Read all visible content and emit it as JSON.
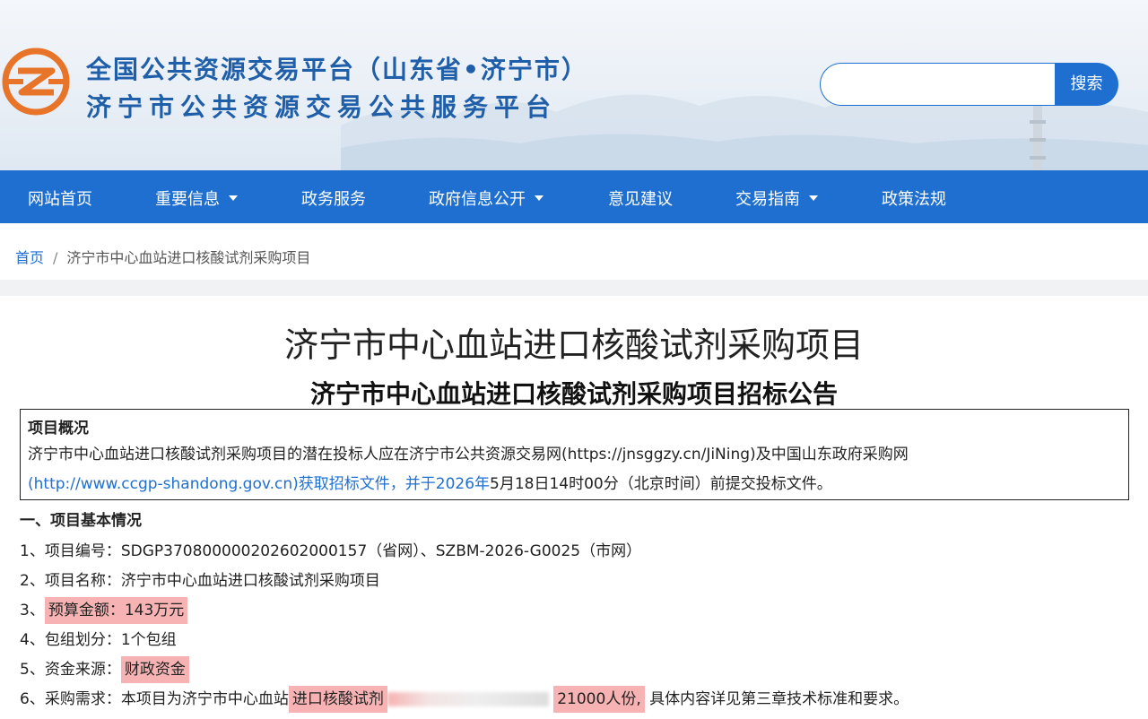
{
  "header": {
    "title_line1": "全国公共资源交易平台（山东省•济宁市）",
    "title_line2": "济宁市公共资源交易公共服务平台",
    "search_placeholder": "",
    "search_button": "搜索",
    "logo_icon": "jining-resource-logo-icon"
  },
  "nav": {
    "items": [
      {
        "label": "网站首页",
        "dropdown": false
      },
      {
        "label": "重要信息",
        "dropdown": true
      },
      {
        "label": "政务服务",
        "dropdown": false
      },
      {
        "label": "政府信息公开",
        "dropdown": true
      },
      {
        "label": "意见建议",
        "dropdown": false
      },
      {
        "label": "交易指南",
        "dropdown": true
      },
      {
        "label": "政策法规",
        "dropdown": false
      }
    ]
  },
  "breadcrumb": {
    "home": "首页",
    "separator": "/",
    "current": "济宁市中心血站进口核酸试剂采购项目"
  },
  "article": {
    "title": "济宁市中心血站进口核酸试剂采购项目",
    "subtitle": "济宁市中心血站进口核酸试剂采购项目招标公告",
    "overview": {
      "heading": "项目概况",
      "text_part1": "济宁市中心血站进口核酸试剂采购项目的潜在投标人应在济宁市公共资源交易网(https://jnsggzy.cn/JiNing)及中国山东政府采购网",
      "text_part2_blue": "(http://www.ccgp-shandong.gov.cn)获取招标文件，并于2026年",
      "text_part3": "5月18日14时00分（北京时间）前提交投标文件。"
    },
    "section1_heading": "一、项目基本情况",
    "lines": {
      "l1": "1、项目编号：SDGP370800000202602000157（省网）、SZBM-2026-G0025（市网）",
      "l2": "2、项目名称：济宁市中心血站进口核酸试剂采购项目",
      "l3_prefix": "3、",
      "l3_hl": "预算金额：143万元",
      "l4": "4、包组划分：1个包组",
      "l5_prefix": "5、资金来源：",
      "l5_hl": "财政资金",
      "l6_prefix": "6、采购需求：本项目为济宁市中心血站",
      "l6_hl1": "进口核酸试剂",
      "l6_hl2": "21000人份,",
      "l6_suffix": "具体内容详见第三章技术标准和要求。"
    }
  },
  "colors": {
    "brand_blue": "#1f6fd1",
    "title_blue": "#1f5ea8",
    "highlight": "#f7b3b3",
    "logo_orange": "#e8742a"
  }
}
